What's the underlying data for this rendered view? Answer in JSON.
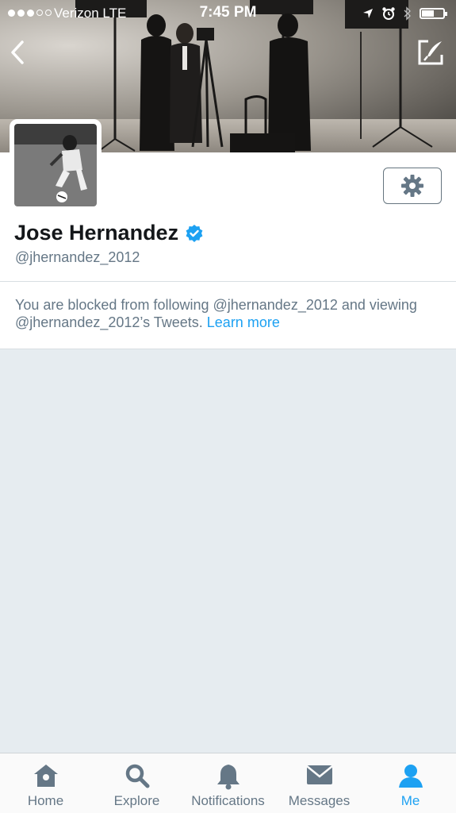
{
  "status_bar": {
    "carrier": "Verizon  LTE",
    "time": "7:45 PM"
  },
  "profile": {
    "name": "Jose Hernandez",
    "handle": "@jhernandez_2012",
    "verified": true
  },
  "notice": {
    "text": "You are blocked from following @jhernandez_2012 and viewing @jhernandez_2012’s Tweets. ",
    "link": "Learn more"
  },
  "tabbar": {
    "tabs": [
      {
        "label": "Home",
        "icon": "home-icon"
      },
      {
        "label": "Explore",
        "icon": "search-icon"
      },
      {
        "label": "Notifications",
        "icon": "bell-icon"
      },
      {
        "label": "Messages",
        "icon": "envelope-icon"
      },
      {
        "label": "Me",
        "icon": "person-icon",
        "active": true
      }
    ]
  },
  "colors": {
    "accent": "#1da1f2",
    "muted_text": "#657786",
    "background": "#e6ecf0",
    "icon_gray": "#657786"
  }
}
